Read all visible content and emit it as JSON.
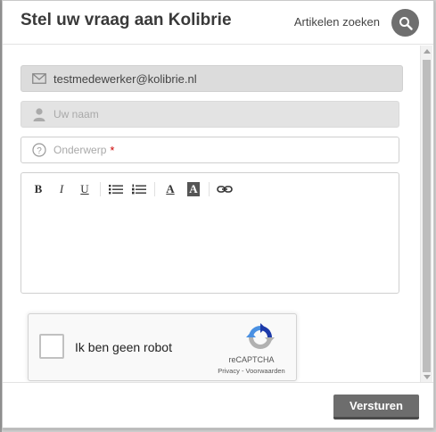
{
  "header": {
    "title": "Stel uw vraag aan Kolibrie",
    "search_link": "Artikelen zoeken",
    "search_icon": "search-icon"
  },
  "form": {
    "email_value": "testmedewerker@kolibrie.nl",
    "name_placeholder": "Uw naam",
    "subject_placeholder": "Onderwerp",
    "required_marker": "*"
  },
  "editor": {
    "toolbar": {
      "bold": "B",
      "italic": "I",
      "underline": "U",
      "text_color": "A",
      "bg_color": "A"
    }
  },
  "captcha": {
    "label": "Ik ben geen robot",
    "brand": "reCAPTCHA",
    "privacy": "Privacy",
    "separator": " - ",
    "terms": "Voorwaarden"
  },
  "footer": {
    "submit_label": "Versturen"
  },
  "colors": {
    "button_bg": "#6d6d6d",
    "required": "#cc0000",
    "recaptcha_blue": "#1c3aa9",
    "recaptcha_light": "#4a90e2",
    "recaptcha_grey": "#b1b1b1"
  }
}
